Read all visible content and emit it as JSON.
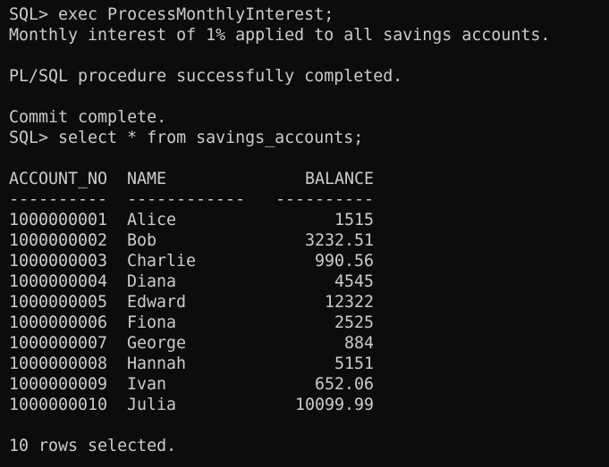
{
  "session": {
    "cmd1": "SQL> exec ProcessMonthlyInterest;",
    "output1": "Monthly interest of 1% applied to all savings accounts.",
    "output2": "PL/SQL procedure successfully completed.",
    "output3": "Commit complete.",
    "cmd2": "SQL> select * from savings_accounts;"
  },
  "table": {
    "headers": [
      "ACCOUNT_NO",
      "NAME",
      "BALANCE"
    ],
    "separators": [
      "----------",
      "------------",
      "----------"
    ],
    "rows": [
      {
        "account_no": "1000000001",
        "name": "Alice",
        "balance": "1515"
      },
      {
        "account_no": "1000000002",
        "name": "Bob",
        "balance": "3232.51"
      },
      {
        "account_no": "1000000003",
        "name": "Charlie",
        "balance": "990.56"
      },
      {
        "account_no": "1000000004",
        "name": "Diana",
        "balance": "4545"
      },
      {
        "account_no": "1000000005",
        "name": "Edward",
        "balance": "12322"
      },
      {
        "account_no": "1000000006",
        "name": "Fiona",
        "balance": "2525"
      },
      {
        "account_no": "1000000007",
        "name": "George",
        "balance": "884"
      },
      {
        "account_no": "1000000008",
        "name": "Hannah",
        "balance": "5151"
      },
      {
        "account_no": "1000000009",
        "name": "Ivan",
        "balance": "652.06"
      },
      {
        "account_no": "1000000010",
        "name": "Julia",
        "balance": "10099.99"
      }
    ],
    "footer": "10 rows selected."
  },
  "colors": {
    "background": "#0c0c0c",
    "text": "#cccccc"
  }
}
